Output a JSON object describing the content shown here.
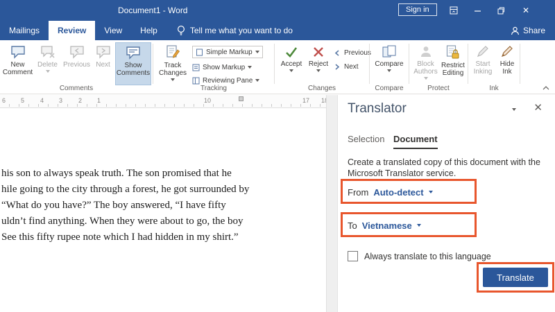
{
  "app": {
    "title": "Document1 - Word",
    "sign_in": "Sign in"
  },
  "colors": {
    "titlebar_blue": "#2b579a",
    "active_tab_text": "#2b579a",
    "annotation_orange": "#e8562d",
    "translate_button_bg": "#2b579a",
    "link_blue": "#2b579a",
    "show_comments_active_bg": "#c6d8ea"
  },
  "icons": {
    "close_glyph": "✕"
  },
  "menu": {
    "tabs": [
      "Mailings",
      "Review",
      "View",
      "Help"
    ],
    "active_tab": "Review",
    "tell_me": "Tell me what you want to do",
    "share": "Share"
  },
  "ribbon": {
    "comments": {
      "label": "Comments",
      "new_comment": "New Comment",
      "delete": "Delete",
      "previous": "Previous",
      "next": "Next",
      "show_comments": "Show Comments"
    },
    "tracking": {
      "label": "Tracking",
      "track_changes": "Track Changes",
      "simple_markup": "Simple Markup",
      "show_markup": "Show Markup",
      "reviewing_pane": "Reviewing Pane"
    },
    "changes": {
      "label": "Changes",
      "accept": "Accept",
      "reject": "Reject",
      "previous": "Previous",
      "next": "Next"
    },
    "compare": {
      "label": "Compare",
      "compare": "Compare"
    },
    "protect": {
      "label": "Protect",
      "block_authors": "Block Authors",
      "restrict_editing": "Restrict Editing"
    },
    "ink": {
      "label": "Ink",
      "start_inking": "Start Inking",
      "hide_ink": "Hide Ink"
    }
  },
  "ruler": {
    "numbers": [
      "6",
      "5",
      "4",
      "3",
      "2",
      "1",
      "10",
      "17",
      "18"
    ]
  },
  "document": {
    "lines": [
      "his son to always speak truth. The son promised that he",
      "hile going to the city through a forest, he got surrounded by",
      "“What do you have?” The boy answered, “I have fifty",
      "uldn’t find anything. When they were about to go, the boy",
      "See this fifty rupee note which I had hidden in my shirt.”"
    ]
  },
  "translator": {
    "title": "Translator",
    "tab_selection": "Selection",
    "tab_document": "Document",
    "description": "Create a translated copy of this document with the Microsoft Translator service.",
    "from_label": "From",
    "from_value": "Auto-detect",
    "to_label": "To",
    "to_value": "Vietnamese",
    "always_translate_label": "Always translate to this language",
    "translate_button": "Translate"
  }
}
